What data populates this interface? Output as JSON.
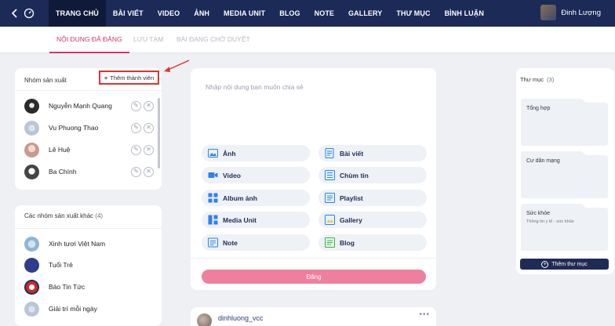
{
  "nav": {
    "items": [
      "TRANG CHỦ",
      "BÀI VIẾT",
      "VIDEO",
      "ẢNH",
      "MEDIA UNIT",
      "BLOG",
      "NOTE",
      "GALLERY",
      "THƯ MỤC",
      "BÌNH LUẬN"
    ],
    "user_name": "Đinh Lượng"
  },
  "subtabs": [
    "NỘI DUNG ĐÃ ĐĂNG",
    "LƯU TẠM",
    "BÀI ĐANG CHỜ DUYỆT"
  ],
  "group": {
    "title": "Nhóm sản xuất",
    "add_label": "Thêm thành viên",
    "members": [
      {
        "name": "Nguyễn Mạnh Quang"
      },
      {
        "name": "Vu Phuong Thao"
      },
      {
        "name": "Lê Huệ"
      },
      {
        "name": "Ba Chính"
      }
    ]
  },
  "other_groups": {
    "title": "Các nhóm sản xuất khác",
    "count": "(4)",
    "items": [
      {
        "name": "Xinh tươi Việt Nam"
      },
      {
        "name": "Tuổi Trẻ"
      },
      {
        "name": "Báo Tin Tức"
      },
      {
        "name": "Giải trí mỗi ngày"
      }
    ]
  },
  "composer": {
    "placeholder": "Nhập nội dung bạn muốn chia sẻ",
    "options": [
      {
        "label": "Ảnh",
        "icon": "image-icon"
      },
      {
        "label": "Bài viết",
        "icon": "article-icon"
      },
      {
        "label": "Video",
        "icon": "video-icon"
      },
      {
        "label": "Chùm tin",
        "icon": "news-cluster-icon"
      },
      {
        "label": "Album ảnh",
        "icon": "album-icon"
      },
      {
        "label": "Playlist",
        "icon": "playlist-icon"
      },
      {
        "label": "Media Unit",
        "icon": "media-unit-icon"
      },
      {
        "label": "Gallery",
        "icon": "gallery-icon"
      },
      {
        "label": "Note",
        "icon": "note-icon"
      },
      {
        "label": "Blog",
        "icon": "blog-icon"
      }
    ],
    "post_label": "Đăng"
  },
  "feed": {
    "username": "dinhluong_vcc"
  },
  "folders": {
    "title": "Thư mục",
    "count": "(3)",
    "items": [
      {
        "title": "Tổng hợp",
        "desc": ""
      },
      {
        "title": "Cư dân mạng",
        "desc": ""
      },
      {
        "title": "Sức khỏe",
        "desc": "Thông tin y tế - sức khỏe"
      }
    ],
    "add_label": "Thêm thư mục"
  },
  "colors": {
    "nav_bg": "#1b2a57",
    "accent": "#d6336c",
    "post_button": "#ee7f9d",
    "highlight_border": "#e03131"
  }
}
